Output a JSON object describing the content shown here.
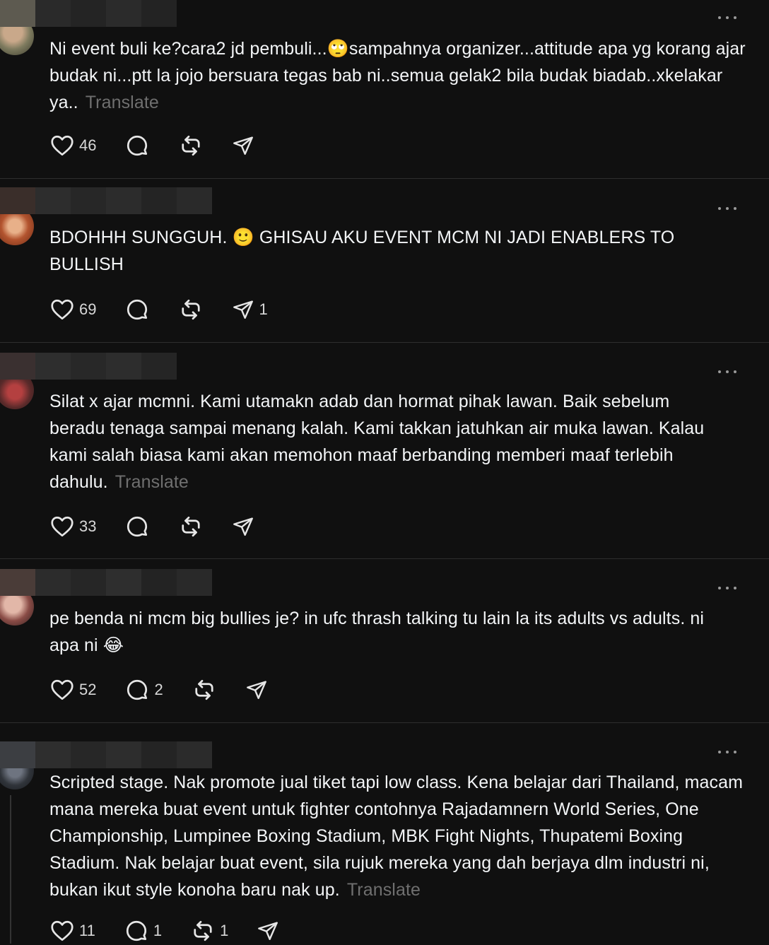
{
  "translate_label": "Translate",
  "icons": [
    "heart-icon",
    "comment-icon",
    "repost-icon",
    "share-icon",
    "more-icon"
  ],
  "posts": [
    {
      "text": "Ni event buli ke?cara2 jd pembuli...🙄sampahnya organizer...attitude apa yg korang ajar budak ni...ptt la jojo bersuara tegas bab ni..semua gelak2 bila budak biadab..xkelakar ya..",
      "translate": "Translate",
      "likes": "46",
      "replies": "",
      "reposts": "",
      "shares": ""
    },
    {
      "text": "BDOHHH SUNGGUH. 🙂 GHISAU AKU EVENT MCM NI JADI ENABLERS TO BULLISH",
      "translate": "",
      "likes": "69",
      "replies": "",
      "reposts": "",
      "shares": "1"
    },
    {
      "text": "Silat x ajar mcmni. Kami utamakn adab dan hormat pihak lawan. Baik sebelum beradu tenaga sampai menang kalah. Kami takkan jatuhkan air muka lawan. Kalau kami salah biasa kami akan memohon maaf berbanding memberi maaf terlebih dahulu.",
      "translate": "Translate",
      "likes": "33",
      "replies": "",
      "reposts": "",
      "shares": ""
    },
    {
      "text": "pe benda ni mcm big bullies je? in ufc thrash talking tu lain la its adults vs adults. ni apa ni 😂",
      "translate": "",
      "likes": "52",
      "replies": "2",
      "reposts": "",
      "shares": ""
    },
    {
      "text": "Scripted stage. Nak promote jual tiket tapi low class. Kena belajar dari Thailand, macam mana mereka buat event untuk fighter contohnya Rajadamnern World Series, One Championship, Lumpinee Boxing Stadium, MBK Fight Nights, Thupatemi Boxing Stadium. Nak belajar buat event, sila rujuk mereka yang dah berjaya dlm industri ni, bukan ikut style konoha baru nak up.",
      "translate": "Translate",
      "likes": "11",
      "replies": "1",
      "reposts": "1",
      "shares": ""
    }
  ],
  "colors": {
    "background": "#101010",
    "text": "#f3f5f7",
    "muted": "#6f6f6f",
    "divider": "#2e2e2e"
  }
}
